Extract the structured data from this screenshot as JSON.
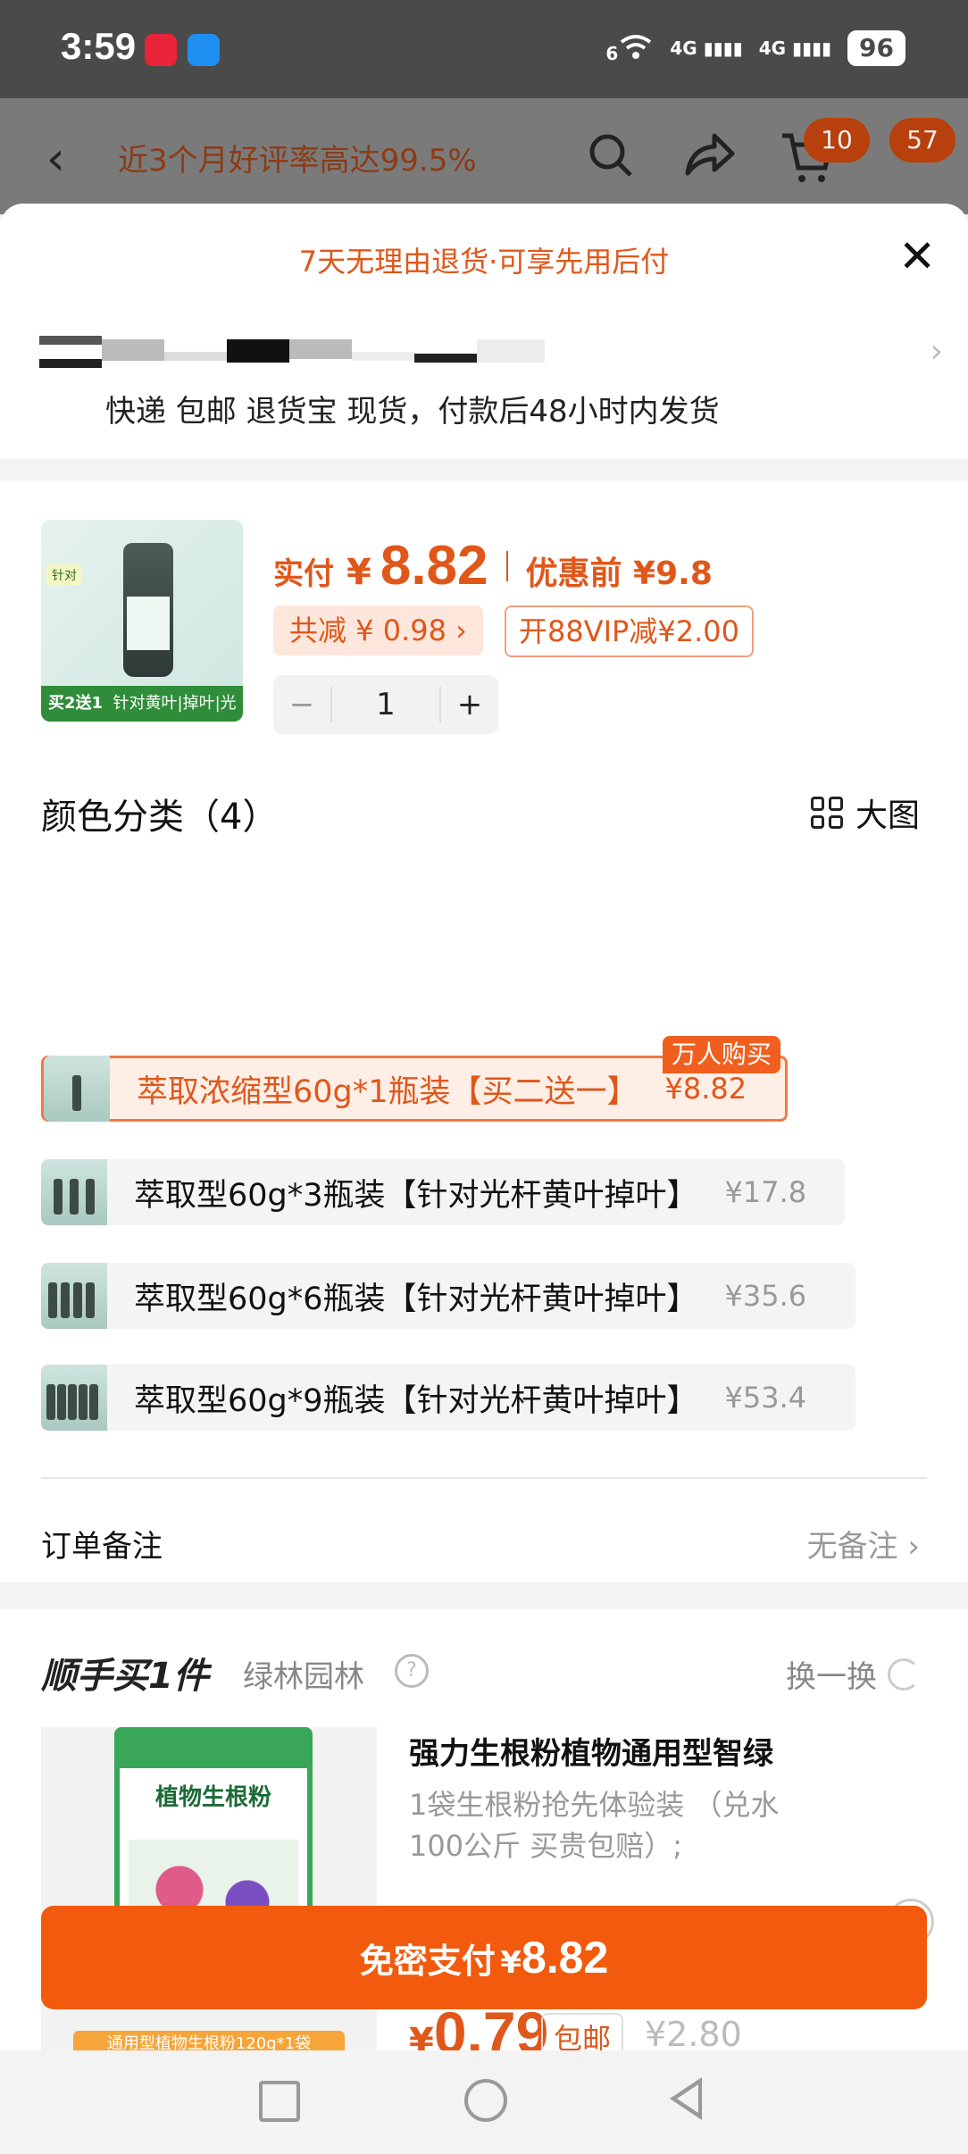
{
  "status_bar": {
    "time": "3:59",
    "net1": "6",
    "net2": "4G",
    "net3": "4G",
    "battery": "96"
  },
  "header": {
    "rating_text": "近3个月好评率高达99.5%",
    "cart_badge": "10",
    "more_badge": "57"
  },
  "sheet": {
    "notice": "7天无理由退货·可享先用后付",
    "shipping": "快递 包邮 退货宝 现货，付款后48小时内发货"
  },
  "product": {
    "thumb_tag": "针对",
    "thumb_promo": "买2送1",
    "thumb_strip": "针对黄叶|掉叶|光杆",
    "actual_label": "实付",
    "currency": "¥",
    "actual_price": "8.82",
    "before_label": "优惠前 ¥9.8",
    "save_chip": "共减 ¥ 0.98 ›",
    "vip_chip": "开88VIP减¥2.00",
    "quantity": "1",
    "minus": "−",
    "plus": "+"
  },
  "category": {
    "title": "颜色分类（4）",
    "big_view": "大图",
    "hot_badge": "万人购买",
    "options": [
      {
        "name": "萃取浓缩型60g*1瓶装【买二送一】",
        "price": "¥8.82"
      },
      {
        "name": "萃取型60g*3瓶装【针对光杆黄叶掉叶】",
        "price": "¥17.8"
      },
      {
        "name": "萃取型60g*6瓶装【针对光杆黄叶掉叶】",
        "price": "¥35.6"
      },
      {
        "name": "萃取型60g*9瓶装【针对光杆黄叶掉叶】",
        "price": "¥53.4"
      }
    ]
  },
  "remark": {
    "label": "订单备注",
    "value": "无备注 ›"
  },
  "addon": {
    "title": "顺手买1件",
    "shop": "绿林园林",
    "help": "?",
    "swap": "换一换",
    "bag_name": "植物生根粉",
    "bag_strip": "通用型植物生根粉120g*1袋",
    "name": "强力生根粉植物通用型智绿",
    "desc": "1袋生根粉抢先体验装 （兑水100公斤 买贵包赔）;",
    "currency": "¥",
    "price": "0.79",
    "free_ship": "包邮",
    "old_price": "¥2.80"
  },
  "pay_button": {
    "label": "免密支付",
    "currency": "¥",
    "amount": "8.82"
  },
  "colors": {
    "accent": "#f25a0d",
    "text_accent": "#e0571a"
  },
  "icons": [
    "back-icon",
    "search-icon",
    "share-icon",
    "cart-icon",
    "close-icon",
    "grid-icon",
    "chevron-right-icon",
    "help-icon",
    "refresh-icon"
  ]
}
